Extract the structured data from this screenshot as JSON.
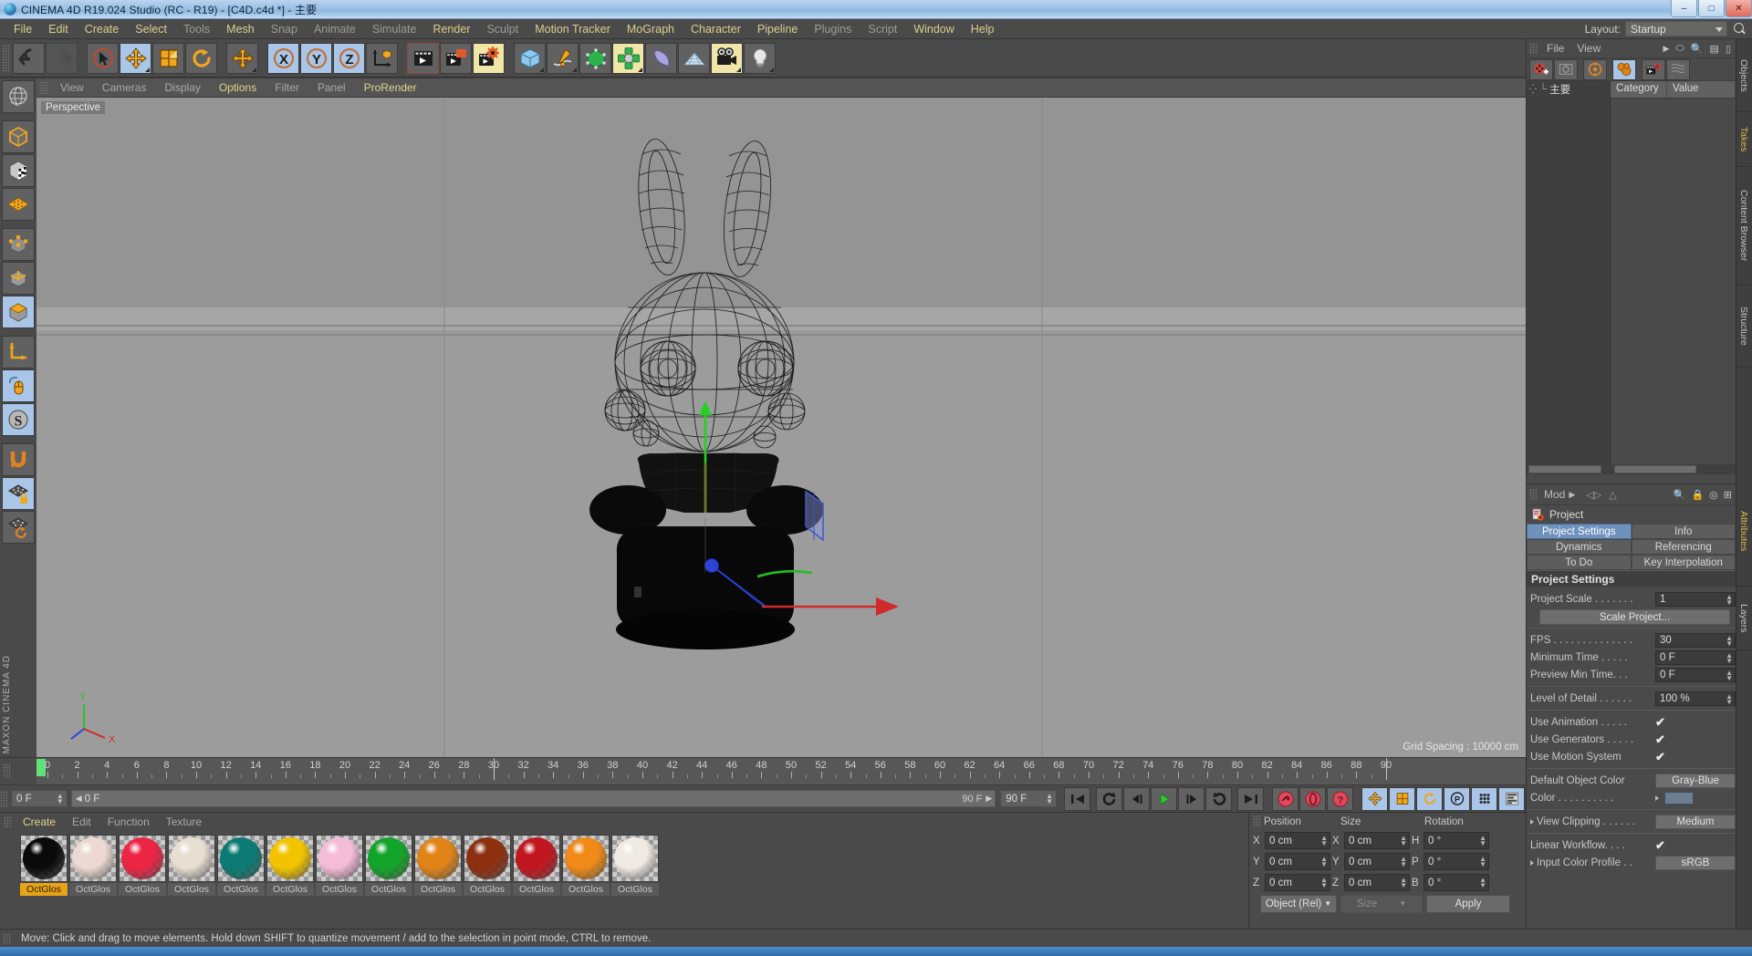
{
  "window": {
    "title": "CINEMA 4D R19.024 Studio (RC - R19) - [C4D.c4d *] - 主要",
    "app_icon": "c4d-logo-icon",
    "minimize": "–",
    "maximize": "□",
    "close": "✕"
  },
  "menubar": {
    "items": [
      {
        "label": "File",
        "dim": false
      },
      {
        "label": "Edit",
        "dim": false
      },
      {
        "label": "Create",
        "dim": false
      },
      {
        "label": "Select",
        "dim": false
      },
      {
        "label": "Tools",
        "dim": true
      },
      {
        "label": "Mesh",
        "dim": false
      },
      {
        "label": "Snap",
        "dim": true
      },
      {
        "label": "Animate",
        "dim": true
      },
      {
        "label": "Simulate",
        "dim": true
      },
      {
        "label": "Render",
        "dim": false
      },
      {
        "label": "Sculpt",
        "dim": true
      },
      {
        "label": "Motion Tracker",
        "dim": false
      },
      {
        "label": "MoGraph",
        "dim": false
      },
      {
        "label": "Character",
        "dim": false
      },
      {
        "label": "Pipeline",
        "dim": false
      },
      {
        "label": "Plugins",
        "dim": true
      },
      {
        "label": "Script",
        "dim": true
      },
      {
        "label": "Window",
        "dim": false
      },
      {
        "label": "Help",
        "dim": false
      }
    ],
    "layout_label": "Layout:",
    "layout_value": "Startup",
    "search_icon": "search-icon"
  },
  "main_toolbar": {
    "groups": [
      {
        "buttons": [
          {
            "name": "undo-button",
            "icon": "undo-arrow-icon",
            "state": "normal"
          },
          {
            "name": "redo-button",
            "icon": "redo-arrow-icon",
            "state": "disabled"
          }
        ]
      },
      {
        "buttons": [
          {
            "name": "live-selection-tool",
            "icon": "cursor-circle-icon",
            "state": "normal"
          },
          {
            "name": "move-tool",
            "icon": "move-arrows-icon",
            "state": "active"
          },
          {
            "name": "scale-tool",
            "icon": "scale-box-icon",
            "state": "normal"
          },
          {
            "name": "rotate-tool",
            "icon": "rotate-circle-icon",
            "state": "normal"
          }
        ]
      },
      {
        "buttons": [
          {
            "name": "move-duplicate-tool",
            "icon": "move-arrows-icon",
            "state": "normal"
          }
        ]
      },
      {
        "buttons": [
          {
            "name": "lock-x-axis-button",
            "icon": "axis-x-icon",
            "state": "active"
          },
          {
            "name": "lock-y-axis-button",
            "icon": "axis-y-icon",
            "state": "active"
          },
          {
            "name": "lock-z-axis-button",
            "icon": "axis-z-icon",
            "state": "active"
          },
          {
            "name": "world-object-coordinates-button",
            "icon": "world-axis-cube-icon",
            "state": "normal"
          }
        ]
      },
      {
        "buttons": [
          {
            "name": "render-view-button",
            "icon": "render-clapper-icon",
            "state": "normal"
          },
          {
            "name": "render-to-picture-viewer-button",
            "icon": "render-picture-icon",
            "state": "normal"
          },
          {
            "name": "render-settings-button",
            "icon": "render-settings-gear-icon",
            "state": "highlighted"
          }
        ]
      },
      {
        "buttons": [
          {
            "name": "add-cube-object-button",
            "icon": "cube-icon",
            "state": "normal"
          },
          {
            "name": "add-spline-button",
            "icon": "pen-spline-icon",
            "state": "normal"
          },
          {
            "name": "add-nurbs-button",
            "icon": "green-cube-nurbs-icon",
            "state": "normal"
          },
          {
            "name": "add-array-button",
            "icon": "array-cluster-icon",
            "state": "highlighted"
          },
          {
            "name": "add-bend-deformer-button",
            "icon": "bend-deformer-icon",
            "state": "normal"
          },
          {
            "name": "add-floor-button",
            "icon": "floor-grid-icon",
            "state": "normal"
          },
          {
            "name": "add-camera-button",
            "icon": "camera-icon",
            "state": "highlighted"
          },
          {
            "name": "add-light-button",
            "icon": "light-bulb-icon",
            "state": "normal"
          }
        ]
      }
    ]
  },
  "left_toolbar": {
    "buttons": [
      {
        "name": "texture-axis-tool",
        "icon": "texture-globe-icon",
        "state": "normal"
      },
      {
        "name": "model-mode-button",
        "icon": "model-cube-icon",
        "state": "normal"
      },
      {
        "name": "texture-mode-button",
        "icon": "checker-cube-icon",
        "state": "normal"
      },
      {
        "name": "workplane-mode-button",
        "icon": "orange-grid-icon",
        "state": "normal"
      },
      {
        "name": "points-mode-button",
        "icon": "points-cube-icon",
        "state": "normal"
      },
      {
        "name": "edges-mode-button",
        "icon": "edges-cube-icon",
        "state": "normal"
      },
      {
        "name": "polygons-mode-button",
        "icon": "polygons-cube-icon",
        "state": "active"
      },
      {
        "name": "object-axis-tool",
        "icon": "axis-corner-icon",
        "state": "normal"
      },
      {
        "name": "viewport-mouse-tool",
        "icon": "mouse-icon",
        "state": "active"
      },
      {
        "name": "soft-selection-tool",
        "icon": "s-circle-icon",
        "state": "active"
      },
      {
        "name": "enable-snap-button",
        "icon": "magnet-icon",
        "state": "normal"
      },
      {
        "name": "lock-workplane-button",
        "icon": "grid-lock-icon",
        "state": "active"
      },
      {
        "name": "workplane-rotate-button",
        "icon": "grid-rotate-icon",
        "state": "normal"
      }
    ],
    "brand": "MAXON CINEMA 4D"
  },
  "viewport": {
    "menus": [
      {
        "label": "View",
        "highlight": false
      },
      {
        "label": "Cameras",
        "highlight": false
      },
      {
        "label": "Display",
        "highlight": false
      },
      {
        "label": "Options",
        "highlight": true
      },
      {
        "label": "Filter",
        "highlight": false
      },
      {
        "label": "Panel",
        "highlight": false
      },
      {
        "label": "ProRender",
        "highlight": true
      }
    ],
    "view_label": "Perspective",
    "grid_spacing": "Grid Spacing : 10000 cm",
    "nav_icons": [
      "move-view-icon",
      "scale-view-icon",
      "rotate-view-icon",
      "maximize-view-icon"
    ],
    "scene_object": "wireframe-bunny-character"
  },
  "timeline": {
    "ticks": [
      0,
      2,
      4,
      6,
      8,
      10,
      12,
      14,
      16,
      18,
      20,
      22,
      24,
      26,
      28,
      30,
      32,
      34,
      36,
      38,
      40,
      42,
      44,
      46,
      48,
      50,
      52,
      54,
      56,
      58,
      60,
      62,
      64,
      66,
      68,
      70,
      72,
      74,
      76,
      78,
      80,
      82,
      84,
      86,
      88,
      90
    ],
    "current_frame": "0 F",
    "end_frame": "90 F",
    "playhead_frame": 0,
    "range_start": "0 F",
    "range_end": "90 F",
    "preview_end": "90 F"
  },
  "transport": {
    "current_frame_field": "0 F",
    "scrub_field": "0 F",
    "range_end_small": "90 F",
    "preview_end_field": "90 F",
    "buttons": [
      {
        "name": "go-to-start-button",
        "icon": "skip-start-icon",
        "state": "normal"
      },
      {
        "name": "go-to-previous-keyframe-button",
        "icon": "prev-key-icon",
        "state": "normal"
      },
      {
        "name": "step-back-button",
        "icon": "step-back-icon",
        "state": "normal"
      },
      {
        "name": "play-button",
        "icon": "play-icon",
        "state": "normal"
      },
      {
        "name": "step-forward-button",
        "icon": "step-forward-icon",
        "state": "normal"
      },
      {
        "name": "go-to-next-keyframe-button",
        "icon": "next-key-icon",
        "state": "normal"
      },
      {
        "name": "go-to-end-button",
        "icon": "skip-end-icon",
        "state": "normal"
      },
      {
        "name": "record-active-objects-button",
        "icon": "record-key-icon",
        "state": "normal"
      },
      {
        "name": "autokeying-button",
        "icon": "autokey-icon",
        "state": "normal"
      },
      {
        "name": "keyframe-selection-button",
        "icon": "question-key-icon",
        "state": "normal"
      },
      {
        "name": "position-key-button",
        "icon": "move-arrows-icon",
        "state": "active"
      },
      {
        "name": "scale-key-button",
        "icon": "scale-box-icon",
        "state": "active"
      },
      {
        "name": "rotation-key-button",
        "icon": "rotate-circle-icon",
        "state": "active"
      },
      {
        "name": "pla-key-button",
        "icon": "p-circle-icon",
        "state": "active"
      },
      {
        "name": "parameter-key-button",
        "icon": "dots-grid-icon",
        "state": "active"
      },
      {
        "name": "point-level-animation-button",
        "icon": "timeline-bars-icon",
        "state": "active"
      }
    ]
  },
  "material_manager": {
    "menus": [
      {
        "label": "Create",
        "highlight": true
      },
      {
        "label": "Edit",
        "highlight": false
      },
      {
        "label": "Function",
        "highlight": false
      },
      {
        "label": "Texture",
        "highlight": false
      }
    ],
    "materials": [
      {
        "name": "OctGlos",
        "color": "#0a0a0a",
        "selected": true
      },
      {
        "name": "OctGlos",
        "color": "#ecdad2",
        "selected": false
      },
      {
        "name": "OctGlos",
        "color": "#ec2545",
        "selected": false
      },
      {
        "name": "OctGlos",
        "color": "#e8ded2",
        "selected": false
      },
      {
        "name": "OctGlos",
        "color": "#0b7b74",
        "selected": false
      },
      {
        "name": "OctGlos",
        "color": "#f2c400",
        "selected": false
      },
      {
        "name": "OctGlos",
        "color": "#f5bcd8",
        "selected": false
      },
      {
        "name": "OctGlos",
        "color": "#13a42a",
        "selected": false
      },
      {
        "name": "OctGlos",
        "color": "#e08418",
        "selected": false
      },
      {
        "name": "OctGlos",
        "color": "#8c3010",
        "selected": false
      },
      {
        "name": "OctGlos",
        "color": "#c1161f",
        "selected": false
      },
      {
        "name": "OctGlos",
        "color": "#f08a18",
        "selected": false
      },
      {
        "name": "OctGlos",
        "color": "#f0eae4",
        "selected": false
      }
    ]
  },
  "coordinates": {
    "headers": [
      "Position",
      "Size",
      "Rotation"
    ],
    "rows": [
      {
        "pos_axis": "X",
        "pos_value": "0 cm",
        "size_axis": "X",
        "size_value": "0 cm",
        "rot_axis": "H",
        "rot_value": "0 °"
      },
      {
        "pos_axis": "Y",
        "pos_value": "0 cm",
        "size_axis": "Y",
        "size_value": "0 cm",
        "rot_axis": "P",
        "rot_value": "0 °"
      },
      {
        "pos_axis": "Z",
        "pos_value": "0 cm",
        "size_axis": "Z",
        "size_value": "0 cm",
        "rot_axis": "B",
        "rot_value": "0 °"
      }
    ],
    "mode_button": "Object (Rel)",
    "size_button": "Size",
    "apply_button": "Apply"
  },
  "object_manager": {
    "menus": [
      "File",
      "View"
    ],
    "toolbar_icons": [
      {
        "name": "add-take-button",
        "icon": "add-take-icon",
        "state": "normal"
      },
      {
        "name": "override-group-button",
        "icon": "override-group-icon",
        "state": "normal"
      },
      {
        "name": "auto-take-button",
        "icon": "auto-take-icon",
        "state": "normal"
      },
      {
        "name": "take-override-button",
        "icon": "take-override-icon",
        "state": "active"
      },
      {
        "name": "render-take-button",
        "icon": "render-take-icon",
        "state": "normal"
      },
      {
        "name": "take-list-button",
        "icon": "take-list-icon",
        "state": "normal"
      }
    ],
    "tree": [
      {
        "label": "主要",
        "icon": "take-node-icon"
      }
    ],
    "columns": [
      "Category",
      "Value"
    ]
  },
  "attributes": {
    "mode_label": "Mod",
    "object_title": "Project",
    "object_icon": "project-settings-icon",
    "tabs": [
      {
        "label": "Project Settings",
        "active": true
      },
      {
        "label": "Info",
        "active": false
      },
      {
        "label": "Dynamics",
        "active": false
      },
      {
        "label": "Referencing",
        "active": false
      },
      {
        "label": "To Do",
        "active": false
      },
      {
        "label": "Key Interpolation",
        "active": false
      }
    ],
    "section_title": "Project Settings",
    "properties": [
      {
        "label": "Project Scale . . . . . . .",
        "type": "field",
        "value": "1"
      },
      {
        "label": "Scale Project...",
        "type": "wide_button",
        "value": "Scale Project..."
      },
      {
        "label": "FPS . . . . . . . . . . . . . .",
        "type": "field",
        "value": "30"
      },
      {
        "label": "Minimum Time . . . . .",
        "type": "field",
        "value": "0 F"
      },
      {
        "label": "Preview Min Time. . .",
        "type": "field",
        "value": "0 F"
      },
      {
        "label": "Level of Detail . . . . . .",
        "type": "field",
        "value": "100 %"
      },
      {
        "label": "Use Animation . . . . .",
        "type": "check",
        "value": "✔"
      },
      {
        "label": "Use Generators . . . . .",
        "type": "check",
        "value": "✔"
      },
      {
        "label": "Use Motion System",
        "type": "check",
        "value": "✔"
      },
      {
        "label": "Default Object Color",
        "type": "button",
        "value": "Gray-Blue"
      },
      {
        "label": "Color . . . . . . . . . .",
        "type": "swatch",
        "value": "#6d7e93"
      },
      {
        "label": "View Clipping . . . . . .",
        "type": "button",
        "value": "Medium",
        "arrow": true
      },
      {
        "label": "Linear Workflow. . . .",
        "type": "check",
        "value": "✔"
      },
      {
        "label": "Input Color Profile . .",
        "type": "button",
        "value": "sRGB",
        "arrow": true
      }
    ]
  },
  "vertical_tabs": [
    {
      "label": "Objects",
      "highlight": false
    },
    {
      "label": "Takes",
      "highlight": true
    },
    {
      "label": "Content Browser",
      "highlight": false
    },
    {
      "label": "Structure",
      "highlight": false
    },
    {
      "label": "Attributes",
      "highlight": true
    },
    {
      "label": "Layers",
      "highlight": false
    }
  ],
  "statusbar": {
    "text": "Move: Click and drag to move elements. Hold down SHIFT to quantize movement / add to the selection in point mode, CTRL to remove."
  },
  "colors": {
    "panel_bg": "#4a4a4a",
    "field_bg": "#3b3b3b",
    "accent_active": "#a9c6e8",
    "accent_yellow": "#ded58e",
    "selected_material": "#e8a317",
    "viewport_bg": "#9d9d9d",
    "axis_x": "#d42a2a",
    "axis_y": "#3ad43a",
    "axis_z": "#3a5ad4"
  }
}
